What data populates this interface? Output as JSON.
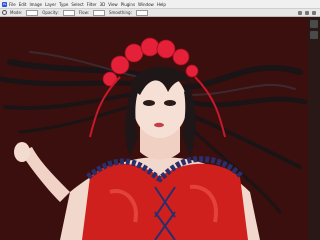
{
  "app": {
    "name": "Photoshop",
    "logo_text": "Ps"
  },
  "menu": {
    "items": [
      "File",
      "Edit",
      "Image",
      "Layer",
      "Type",
      "Select",
      "Filter",
      "3D",
      "View",
      "Plugins",
      "Window",
      "Help"
    ]
  },
  "options": {
    "mode_label": "Mode:",
    "opacity_label": "Opacity:",
    "flow_label": "Flow:",
    "smoothing_label": "Smoothing:"
  },
  "icons": {
    "tool": "brush-icon",
    "right_panel": [
      "panel-icon",
      "panel-icon"
    ]
  },
  "colors": {
    "canvas_bg": "#3a0f0d",
    "hair": "#1a1416",
    "dress": "#d0201e",
    "ruffle": "#2a2e6a",
    "roses": "#e5213a"
  }
}
